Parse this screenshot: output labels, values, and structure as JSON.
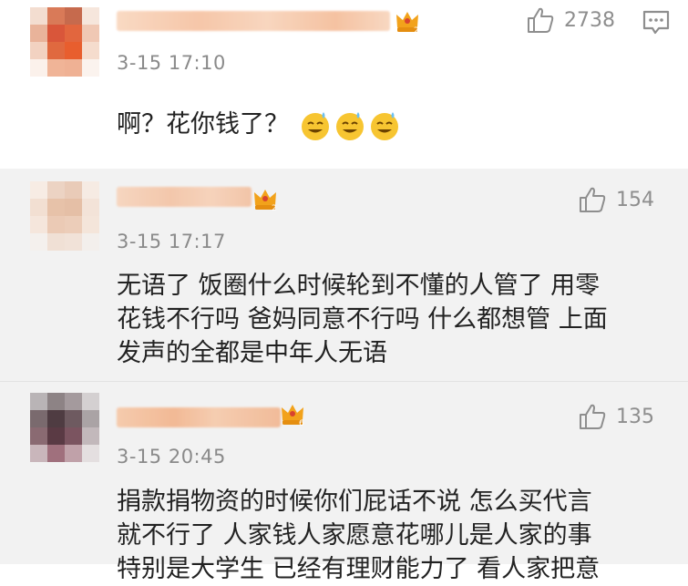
{
  "comments": [
    {
      "timestamp": "3-15 17:10",
      "likes": "2738",
      "lines": [
        "啊？花你钱了？"
      ],
      "emojis": [
        "sweat-smile-emoji",
        "sweat-smile-emoji",
        "sweat-smile-emoji"
      ],
      "badge_level": "2"
    },
    {
      "timestamp": "3-15 17:17",
      "likes": "154",
      "lines": [
        "无语了 饭圈什么时候轮到不懂的人管了 用零",
        "花钱不行吗 爸妈同意不行吗 什么都想管 上面",
        "发声的全都是中年人无语"
      ],
      "badge_level": "2"
    },
    {
      "timestamp": "3-15 20:45",
      "likes": "135",
      "lines": [
        "捐款捐物资的时候你们屁话不说 怎么买代言",
        "就不行了 人家钱人家愿意花哪儿是人家的事",
        "特别是大学生 已经有理财能力了 看人家把意"
      ],
      "badge_level": "6"
    }
  ],
  "colors": {
    "name_blur": "#f7c6a3",
    "badge": "#f2a21b",
    "text": "#222222",
    "meta": "#8a8a8a"
  }
}
